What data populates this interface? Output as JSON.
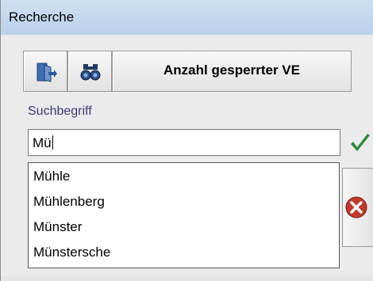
{
  "window": {
    "title": "Recherche"
  },
  "toolbar": {
    "exit_icon": "exit-door-icon",
    "search_icon": "binoculars-icon",
    "count_button_label": "Anzahl gesperrter VE"
  },
  "search": {
    "label": "Suchbegriff",
    "value": "Mü"
  },
  "actions": {
    "confirm_icon": "checkmark-icon",
    "cancel_icon": "cancel-icon"
  },
  "suggestions": [
    "Mühle",
    "Mühlenberg",
    "Münster",
    "Münstersche"
  ],
  "colors": {
    "label": "#3e3a78",
    "confirm": "#2e8b3b",
    "cancel": "#c0392b"
  }
}
